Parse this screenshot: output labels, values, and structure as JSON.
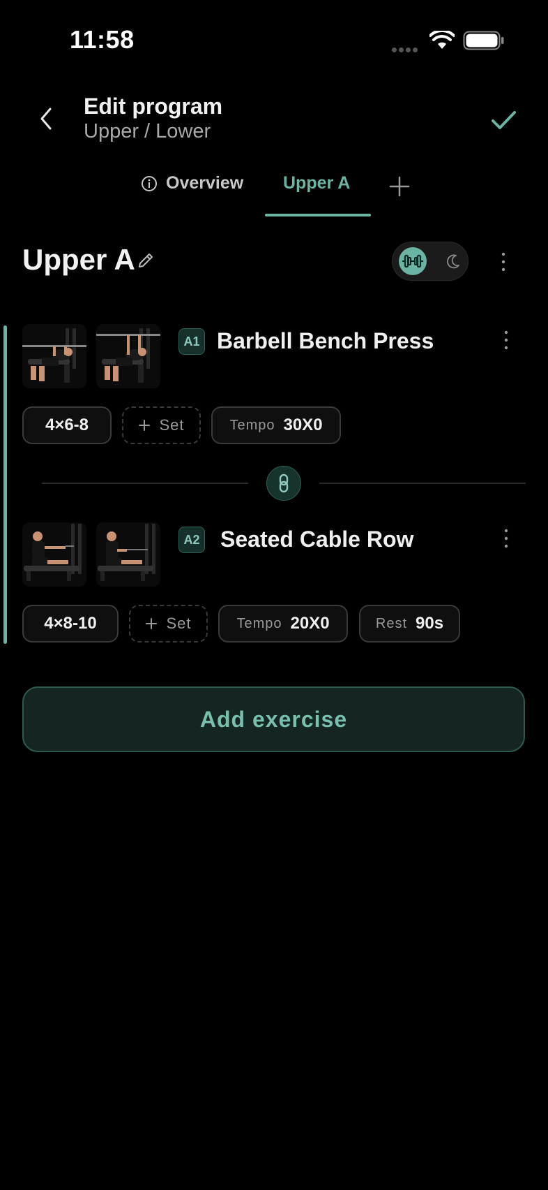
{
  "status_bar": {
    "time": "11:58"
  },
  "header": {
    "title": "Edit program",
    "subtitle": "Upper / Lower"
  },
  "tabs": [
    {
      "label": "Overview",
      "active": false
    },
    {
      "label": "Upper A",
      "active": true
    }
  ],
  "day": {
    "title": "Upper A"
  },
  "colors": {
    "accent": "#6bb3a3",
    "background": "#000000"
  },
  "exercises": [
    {
      "badge": "A1",
      "name": "Barbell Bench Press",
      "sets_reps": "4×6-8",
      "add_set_label": "Set",
      "tempo_label": "Tempo",
      "tempo_value": "30X0"
    },
    {
      "badge": "A2",
      "name": "Seated Cable Row",
      "sets_reps": "4×8-10",
      "add_set_label": "Set",
      "tempo_label": "Tempo",
      "tempo_value": "20X0",
      "rest_label": "Rest",
      "rest_value": "90s"
    }
  ],
  "add_exercise_label": "Add exercise",
  "icons": [
    "back-chevron-icon",
    "checkmark-icon",
    "info-icon",
    "plus-icon",
    "pencil-icon",
    "dumbbell-icon",
    "moon-icon",
    "kebab-menu-icon",
    "link-icon",
    "wifi-icon",
    "battery-icon"
  ]
}
